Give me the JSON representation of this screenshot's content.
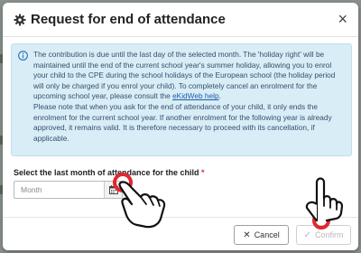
{
  "dialog": {
    "title": "Request for end of attendance",
    "close_glyph": "×",
    "info_paragraph_1": "The contribution is due until the last day of the selected month. The 'holiday right' will be maintained until the end of the current school year's summer holiday, allowing you to enrol your child to the CPE during the school holidays of the European school (the holiday period will only be charged if you enrol your child). To completely cancel an enrolment for the upcoming school year, please consult the ",
    "info_link": "eKidWeb help",
    "info_link_suffix": ".",
    "info_paragraph_2": "Please note that when you ask for the end of attendance of your child, it only ends the enrolment for the current school year. If another enrolment for the following year is already approved, it remains valid. It is therefore necessary to proceed with its cancellation, if applicable.",
    "field_label": "Select the last month of attendance for the child",
    "required_marker": "*",
    "month_placeholder": "Month",
    "month_value": "",
    "cancel_label": "Cancel",
    "cancel_icon": "✕",
    "confirm_label": "Confirm",
    "confirm_icon": "✓"
  },
  "icons": {
    "header": "gear-icon",
    "info": "info-circle-icon",
    "calendar": "calendar-icon",
    "pointer": "hand-pointer-icon"
  },
  "colors": {
    "info_bg": "#d9edf7",
    "info_text": "#31506b",
    "link": "#1a5ca8",
    "required": "#d23a3a",
    "click_marker": "#e3262d",
    "confirm_disabled": "#b8b8b8"
  },
  "state": {
    "confirm_enabled": false
  }
}
